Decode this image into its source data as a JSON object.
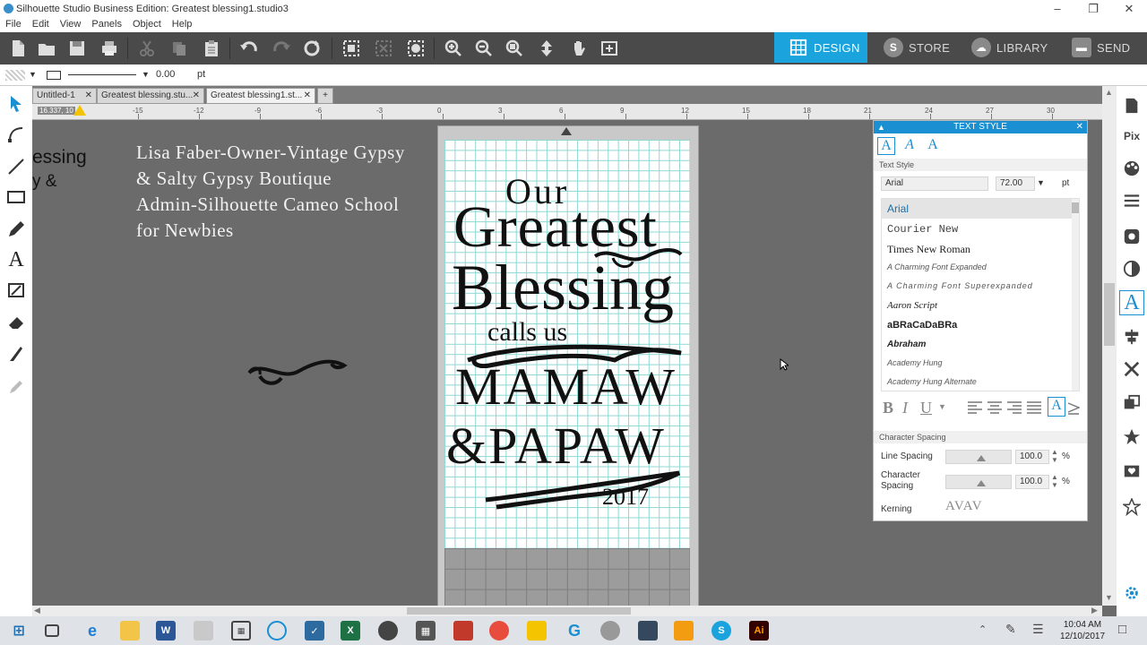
{
  "window": {
    "title": "Silhouette Studio Business Edition: Greatest blessing1.studio3"
  },
  "menu": [
    "File",
    "Edit",
    "View",
    "Panels",
    "Object",
    "Help"
  ],
  "nav_tabs": [
    {
      "label": "DESIGN",
      "active": true
    },
    {
      "label": "STORE",
      "active": false
    },
    {
      "label": "LIBRARY",
      "active": false
    },
    {
      "label": "SEND",
      "active": false
    }
  ],
  "line_bar": {
    "width_value": "0.00",
    "unit": "pt"
  },
  "doc_tabs": [
    {
      "label": "Untitled-1"
    },
    {
      "label": "Greatest blessing.stu..."
    },
    {
      "label": "Greatest blessing1.st..."
    }
  ],
  "ruler": {
    "ticks": [
      "-15",
      "-12",
      "-9",
      "-6",
      "-3",
      "0",
      "3",
      "6",
      "9",
      "12",
      "15",
      "18",
      "21",
      "24",
      "27",
      "30"
    ],
    "readout": "16.337, 10"
  },
  "canvas_text": {
    "partial_line1": "essing",
    "partial_line2": "y &",
    "credit_lines": [
      "Lisa Faber-Owner-Vintage Gypsy",
      "& Salty Gypsy Boutique",
      "Admin-Silhouette Cameo School",
      "for Newbies"
    ]
  },
  "design": {
    "line1": "Our",
    "line2": "Greatest",
    "line3": "Blessing",
    "line4": "calls us",
    "line5": "MAMAW",
    "line6": "&PAPAW",
    "year": "2017"
  },
  "text_style_panel": {
    "title": "TEXT STYLE",
    "section_text_style": "Text Style",
    "font_field": "Arial",
    "size_value": "72.00",
    "size_unit": "pt",
    "fonts": [
      "Arial",
      "Courier New",
      "Times New Roman",
      "A Charming Font Expanded",
      "A Charming Font Superexpanded",
      "Aaron Script",
      "aBRaCaDaBRa",
      "Abraham",
      "Academy Hung",
      "Academy Hung Alternate"
    ],
    "section_character_spacing": "Character Spacing",
    "line_spacing_label": "Line Spacing",
    "line_spacing_value": "100.0",
    "character_spacing_label": "Character Spacing",
    "character_spacing_value": "100.0",
    "percent": "%",
    "kerning_label": "Kerning",
    "kerning_preview": "AVAV",
    "style_buttons": [
      "B",
      "I",
      "U"
    ]
  },
  "taskbar": {
    "time": "10:04 AM",
    "date": "12/10/2017"
  },
  "colors": {
    "accent": "#1aa3dc",
    "toolbar": "#4a4a4a",
    "canvas": "#6b6b6b",
    "grid": "#5fc9c2",
    "panel_header": "#1a8fd1"
  }
}
